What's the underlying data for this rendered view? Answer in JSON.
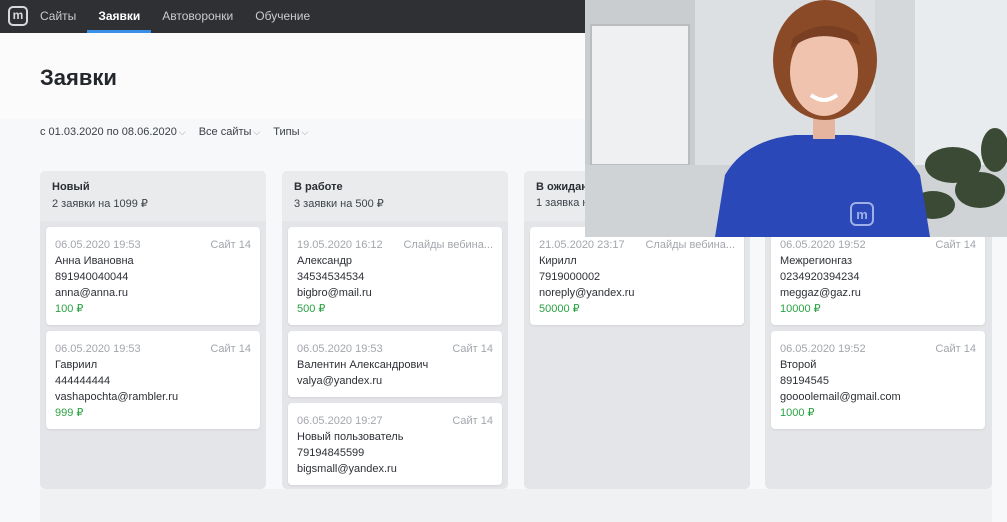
{
  "nav": {
    "logo": "m",
    "items": [
      {
        "label": "Сайты",
        "active": false
      },
      {
        "label": "Заявки",
        "active": true
      },
      {
        "label": "Автоворонки",
        "active": false
      },
      {
        "label": "Обучение",
        "active": false
      }
    ]
  },
  "page": {
    "title": "Заявки"
  },
  "filters": {
    "date_range": "с 01.03.2020 по 08.06.2020",
    "sites": "Все сайты",
    "types": "Типы"
  },
  "columns": [
    {
      "title": "Новый",
      "summary": "2 заявки на 1099 ₽",
      "cards": [
        {
          "date": "06.05.2020 19:53",
          "site": "Сайт 14",
          "name": "Анна Ивановна",
          "phone": "891940040044",
          "email": "anna@anna.ru",
          "price": "100 ₽"
        },
        {
          "date": "06.05.2020 19:53",
          "site": "Сайт 14",
          "name": "Гавриил",
          "phone": "444444444",
          "email": "vashapochta@rambler.ru",
          "price": "999 ₽"
        }
      ]
    },
    {
      "title": "В работе",
      "summary": "3 заявки на 500 ₽",
      "cards": [
        {
          "date": "19.05.2020 16:12",
          "site": "Слайды вебина...",
          "name": "Александр",
          "phone": "34534534534",
          "email": "bigbro@mail.ru",
          "price": "500 ₽"
        },
        {
          "date": "06.05.2020 19:53",
          "site": "Сайт 14",
          "name": "Валентин Александрович",
          "email": "valya@yandex.ru"
        },
        {
          "date": "06.05.2020 19:27",
          "site": "Сайт 14",
          "name": "Новый пользователь",
          "phone": "79194845599",
          "email": "bigsmall@yandex.ru"
        }
      ]
    },
    {
      "title": "В ожидан",
      "summary": "1 заявка н",
      "cards": [
        {
          "date": "21.05.2020 23:17",
          "site": "Слайды вебина...",
          "name": "Кирилл",
          "phone": "7919000002",
          "email": "noreply@yandex.ru",
          "price": "50000 ₽"
        }
      ]
    },
    {
      "cards": [
        {
          "date": "06.05.2020 19:52",
          "site": "Сайт 14",
          "name": "Межрегионгаз",
          "phone": "0234920394234",
          "email": "meggaz@gaz.ru",
          "price": "10000 ₽"
        },
        {
          "date": "06.05.2020 19:52",
          "site": "Сайт 14",
          "name": "Второй",
          "phone": "89194545",
          "email": "goooolemail@gmail.com",
          "price": "1000 ₽"
        }
      ]
    }
  ],
  "video_overlay": {
    "logo": "m"
  },
  "colors": {
    "topbar": "#2f3033",
    "accent": "#3a8ee6",
    "price": "#2aa243",
    "column_bg": "#e3e5e8"
  }
}
